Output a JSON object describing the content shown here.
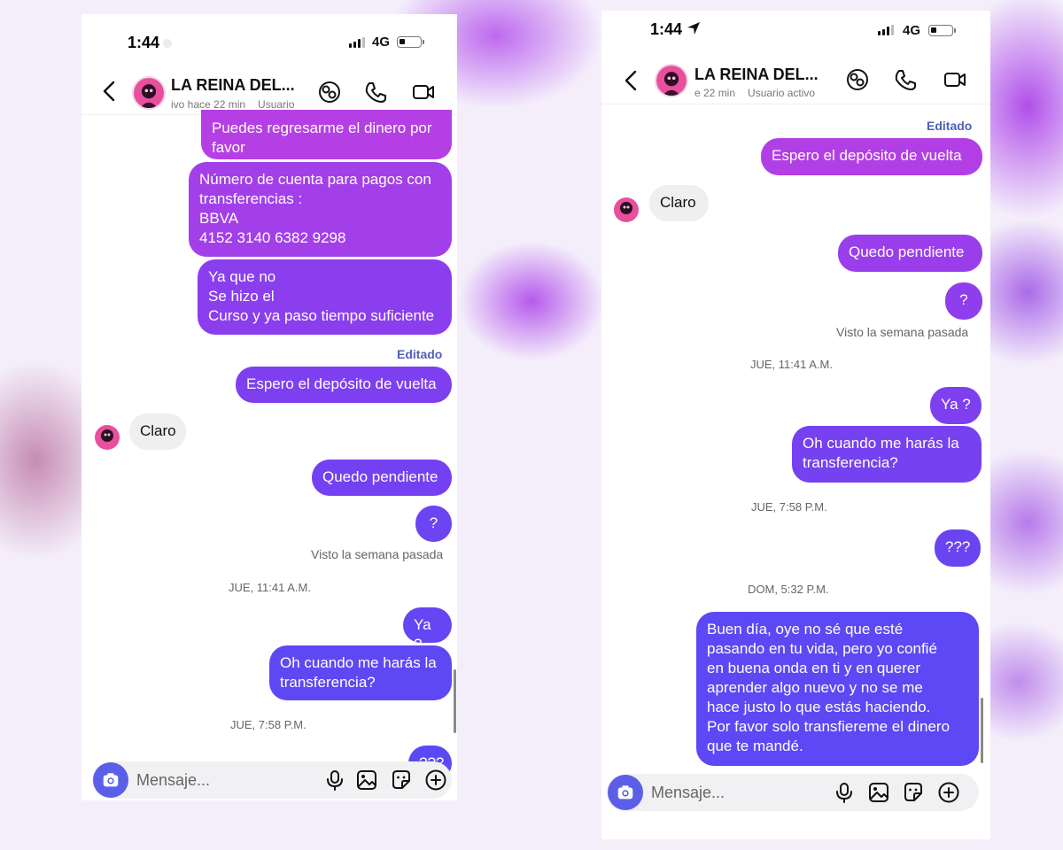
{
  "colors": {
    "bubble_top": "#b73fe6",
    "bubble_mid": "#8a3cf0",
    "bubble_bottom": "#5b4cf5",
    "incoming": "#efefef",
    "edited": "#4f5fb8"
  },
  "left": {
    "status": {
      "time": "1:44",
      "network": "4G"
    },
    "header": {
      "name": "LA REINA DEL...",
      "sub1": "ivo hace 22 min",
      "sub2": "Usuario"
    },
    "messages": {
      "m1": "Puedes regresarme el dinero por\nfavor",
      "m2": "Número de cuenta para pagos con\ntransferencias :\nBBVA\n4152 3140 6382 9298",
      "m3": "Ya que no\nSe hizo el\nCurso y ya paso tiempo suficiente",
      "edited": "Editado",
      "m4": "Espero el depósito de vuelta",
      "claro": "Claro",
      "m5": "Quedo pendiente",
      "m6": "?",
      "seen": "Visto la semana pasada",
      "ts1": "JUE, 11:41 A.M.",
      "m7": "Ya ?",
      "m8": "Oh cuando me harás la\ntransferencia?",
      "ts2": "JUE, 7:58 P.M.",
      "m9": "???"
    },
    "composer": {
      "placeholder": "Mensaje..."
    }
  },
  "right": {
    "status": {
      "time": "1:44",
      "network": "4G"
    },
    "header": {
      "name": "LA REINA DEL...",
      "sub1": "e 22 min",
      "sub2": "Usuario activo"
    },
    "messages": {
      "edited": "Editado",
      "m1": "Espero el depósito de vuelta",
      "claro": "Claro",
      "m2": "Quedo pendiente",
      "m3": "?",
      "seen": "Visto la semana pasada",
      "ts1": "JUE, 11:41 A.M.",
      "m4": "Ya ?",
      "m5": "Oh cuando me harás la\ntransferencia?",
      "ts2": "JUE, 7:58 P.M.",
      "m6": "???",
      "ts3": "DOM, 5:32 P.M.",
      "m7": "Buen día, oye no sé que esté\npasando en tu vida, pero yo confié\nen buena onda en ti y en querer\naprender algo nuevo y no se me\nhace justo lo que estás haciendo.\nPor favor solo transfiereme el dinero\nque te mandé."
    },
    "composer": {
      "placeholder": "Mensaje..."
    }
  }
}
